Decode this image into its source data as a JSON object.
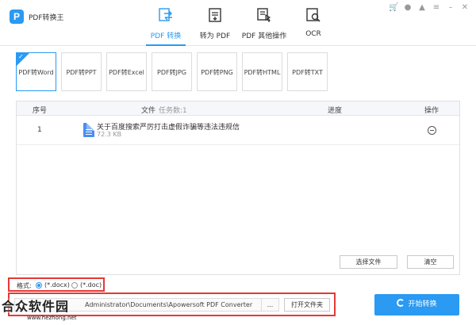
{
  "app": {
    "title": "PDF转换王",
    "logo_letter": "P"
  },
  "nav": [
    {
      "label": "PDF 转换",
      "icon": "convert-icon",
      "active": true
    },
    {
      "label": "转为 PDF",
      "icon": "to-pdf-icon",
      "active": false
    },
    {
      "label": "PDF 其他操作",
      "icon": "pdf-operations-icon",
      "active": false
    },
    {
      "label": "OCR",
      "icon": "ocr-icon",
      "active": false
    }
  ],
  "subtabs": [
    {
      "label": "PDF转Word",
      "active": true
    },
    {
      "label": "PDF转PPT",
      "active": false
    },
    {
      "label": "PDF转Excel",
      "active": false
    },
    {
      "label": "PDF转JPG",
      "active": false
    },
    {
      "label": "PDF转PNG",
      "active": false
    },
    {
      "label": "PDF转HTML",
      "active": false
    },
    {
      "label": "PDF转TXT",
      "active": false
    }
  ],
  "table": {
    "headers": {
      "index": "序号",
      "file": "文件",
      "task_count": "任务数:1",
      "progress": "进度",
      "action": "操作"
    },
    "rows": [
      {
        "index": "1",
        "name": "关于百度搜索严厉打击虚假诈骗等违法违规信",
        "size": "72.3 KB"
      }
    ]
  },
  "buttons": {
    "select_file": "选择文件",
    "clear": "清空",
    "open_folder": "打开文件夹",
    "browse": "...",
    "start": "开始转换"
  },
  "format": {
    "label": "格式:",
    "options": [
      "(*.docx)",
      "(*.doc)"
    ],
    "selected": "(*.docx)"
  },
  "output": {
    "path": "Administrator\\Documents\\Apowersoft PDF Converter"
  },
  "watermark": {
    "text": "合众软件园",
    "url": "www.hezhong.net"
  },
  "colors": {
    "accent": "#2a9af3",
    "highlight_border": "#e53935"
  }
}
